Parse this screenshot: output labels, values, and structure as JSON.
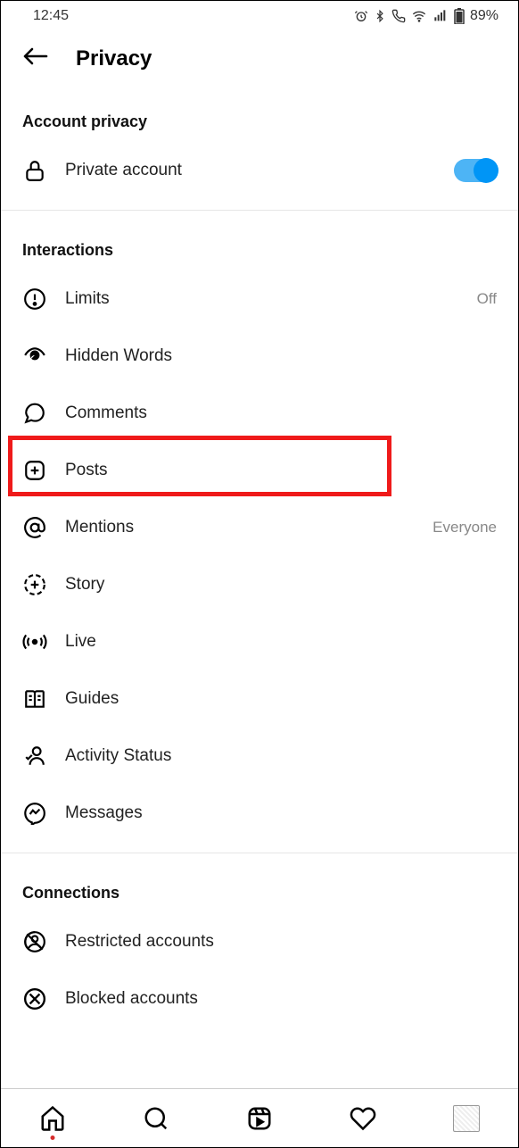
{
  "status": {
    "time": "12:45",
    "battery": "89%"
  },
  "header": {
    "title": "Privacy"
  },
  "sections": {
    "account": {
      "title": "Account privacy",
      "private": {
        "label": "Private account",
        "on": true
      }
    },
    "interactions": {
      "title": "Interactions",
      "limits": {
        "label": "Limits",
        "value": "Off"
      },
      "hidden_words": {
        "label": "Hidden Words"
      },
      "comments": {
        "label": "Comments"
      },
      "posts": {
        "label": "Posts"
      },
      "mentions": {
        "label": "Mentions",
        "value": "Everyone"
      },
      "story": {
        "label": "Story"
      },
      "live": {
        "label": "Live"
      },
      "guides": {
        "label": "Guides"
      },
      "activity_status": {
        "label": "Activity Status"
      },
      "messages": {
        "label": "Messages"
      }
    },
    "connections": {
      "title": "Connections",
      "restricted": {
        "label": "Restricted accounts"
      },
      "blocked": {
        "label": "Blocked accounts"
      }
    }
  }
}
